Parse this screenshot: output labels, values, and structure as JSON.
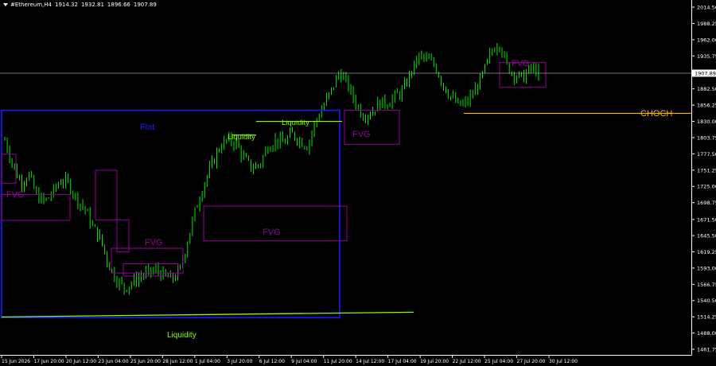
{
  "header": {
    "symbol": "#Ethereum,H4",
    "open": "1914.32",
    "high": "1932.81",
    "low": "1896.66",
    "close": "1907.89"
  },
  "current_price_label": "1907.89",
  "colors": {
    "background": "#000000",
    "bull_candle": "#00ff00",
    "bear_candle": "#00ff00",
    "flat_box": "#1a1aff",
    "fvg_box": "#990099",
    "liquidity": "#80ff00",
    "choch": "#ffb000",
    "price_line": "#a0a0a0",
    "axis": "#ffffff"
  },
  "chart_data": {
    "type": "candlestick",
    "y_axis_ticks": [
      "2014.56",
      "1988.25",
      "1962.00",
      "1935.75",
      "1909.50",
      "1882.56",
      "1856.25",
      "1830.00",
      "1803.75",
      "1777.50",
      "1751.25",
      "1725.00",
      "1698.75",
      "1671.50",
      "1645.50",
      "1619.25",
      "1593.00",
      "1566.75",
      "1540.50",
      "1514.25",
      "1488.00",
      "1461.75"
    ],
    "ylim": [
      1461.75,
      2027.0
    ],
    "x_axis_ticks": [
      "15 Jun 2026",
      "17 Jun 20:00",
      "20 Jun 12:00",
      "23 Jun 04:00",
      "25 Jun 20:00",
      "28 Jun 12:00",
      "1 Jul 04:00",
      "3 Jul 20:00",
      "6 Jul 12:00",
      "9 Jul 04:00",
      "11 Jul 20:00",
      "14 Jul 12:00",
      "17 Jul 04:00",
      "19 Jul 20:00",
      "22 Jul 12:00",
      "25 Jul 04:00",
      "27 Jul 20:00",
      "30 Jul 12:00"
    ],
    "close_path": [
      1800,
      1760,
      1730,
      1745,
      1710,
      1700,
      1715,
      1735,
      1730,
      1705,
      1690,
      1660,
      1640,
      1600,
      1575,
      1560,
      1570,
      1580,
      1585,
      1590,
      1580,
      1575,
      1590,
      1640,
      1690,
      1730,
      1760,
      1790,
      1800,
      1795,
      1770,
      1755,
      1760,
      1790,
      1800,
      1795,
      1810,
      1800,
      1790,
      1830,
      1855,
      1880,
      1910,
      1890,
      1860,
      1840,
      1845,
      1860,
      1860,
      1870,
      1880,
      1910,
      1935,
      1930,
      1920,
      1890,
      1870,
      1855,
      1860,
      1880,
      1905,
      1940,
      1960,
      1920,
      1905,
      1900,
      1915,
      1910
    ],
    "annotations": {
      "flat_label": "Flat",
      "fvg_label": "FVG",
      "liquidity_label": "Liquidity",
      "choch_label": "CHOCH"
    },
    "flat_box": {
      "x_start": "15 Jun 2026",
      "x_end": "12 Jul",
      "y_top": 1848,
      "y_bottom": 1513
    },
    "fvg_boxes": [
      {
        "label_shown": true,
        "y_top": 1712,
        "y_bottom": 1670
      },
      {
        "label_shown": true,
        "y_top": 1625,
        "y_bottom": 1585
      },
      {
        "label_shown": true,
        "y_top": 1693,
        "y_bottom": 1637
      },
      {
        "label_shown": true,
        "y_top": 1848,
        "y_bottom": 1793
      },
      {
        "label_shown": true,
        "y_top": 1925,
        "y_bottom": 1885
      }
    ],
    "liquidity_levels": [
      {
        "label_shown": true,
        "y": 1808
      },
      {
        "label_shown": true,
        "y": 1830
      },
      {
        "label_shown": true,
        "y": 1514
      }
    ],
    "choch_level": 1843,
    "current_price": 1907.89
  }
}
